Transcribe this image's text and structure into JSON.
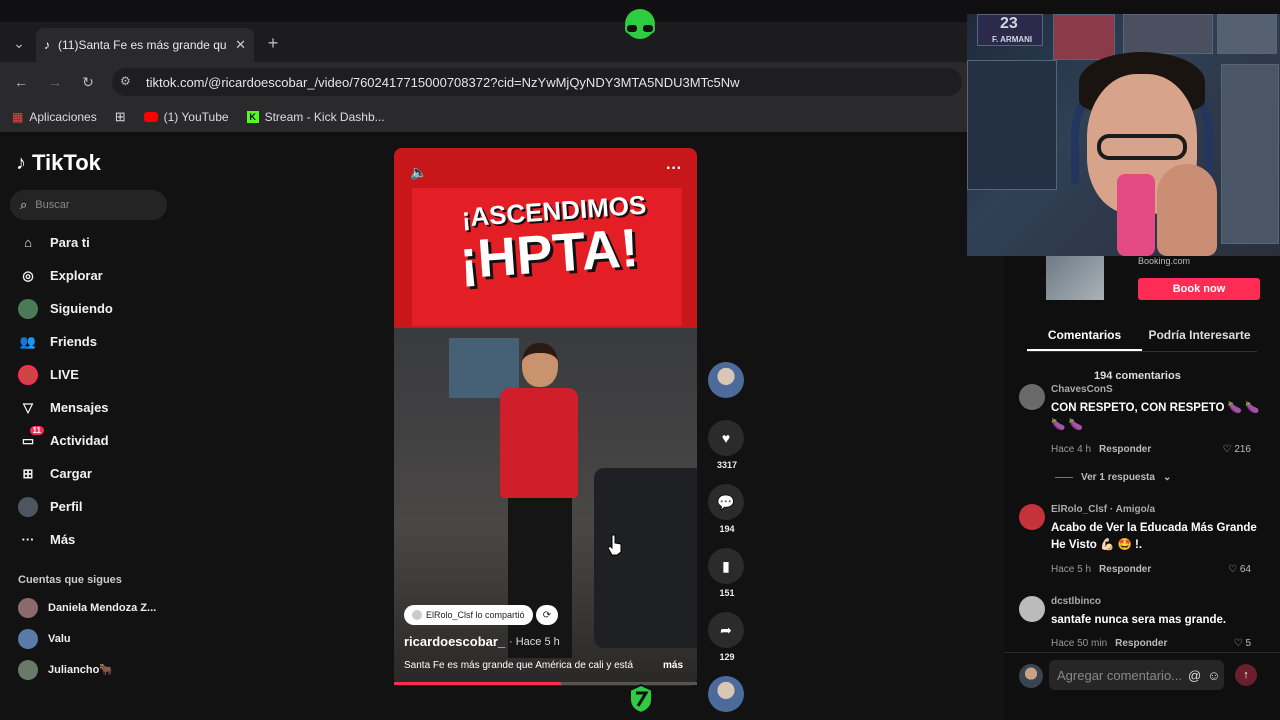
{
  "browser": {
    "tab_title": "(11)Santa Fe es más grande qu",
    "url": "tiktok.com/@ricardoescobar_/video/7602417715000708372?cid=NzYwMjQyNDY3MTA5NDU3MTc5Nw",
    "bookmarks": [
      {
        "label": "Aplicaciones"
      },
      {
        "label": "(1) YouTube"
      },
      {
        "label": "Stream - Kick Dashb..."
      }
    ]
  },
  "sidebar": {
    "brand": "TikTok",
    "search_placeholder": "Buscar",
    "items": [
      {
        "label": "Para ti"
      },
      {
        "label": "Explorar"
      },
      {
        "label": "Siguiendo"
      },
      {
        "label": "Friends"
      },
      {
        "label": "LIVE"
      },
      {
        "label": "Mensajes"
      },
      {
        "label": "Actividad",
        "badge": "11"
      },
      {
        "label": "Cargar"
      },
      {
        "label": "Perfil"
      },
      {
        "label": "Más"
      }
    ],
    "following_title": "Cuentas que sigues",
    "following": [
      {
        "label": "Daniela Mendoza Z..."
      },
      {
        "label": "Valu"
      },
      {
        "label": "Juliancho🐂"
      }
    ]
  },
  "video": {
    "overlay_line1": "¡ASCENDIMOS",
    "overlay_line2": "¡HPTA!",
    "shared_by": "ElRolo_Clsf lo compartió",
    "author": "ricardoescobar_",
    "time": "· Hace 5 h",
    "description": "Santa Fe es más grande que América de cali y está",
    "more": "más",
    "progress": 0.55
  },
  "actions": {
    "likes": "3317",
    "comments": "194",
    "saves": "151",
    "shares": "129"
  },
  "webcam": {
    "poster_text": "F. ARMANI",
    "poster_number": "23"
  },
  "ad": {
    "source": "Booking.com",
    "cta": "Book now"
  },
  "comments_panel": {
    "tabs": [
      "Comentarios",
      "Podría Interesarte"
    ],
    "count": "194 comentarios",
    "comments": [
      {
        "user": "ChavesConS",
        "text": "CON RESPETO, CON RESPETO 🍆 🍆 🍆 🍆",
        "time": "Hace 4 h",
        "reply": "Responder",
        "likes": "216"
      },
      {
        "user": "ElRolo_Clsf · Amigo/a",
        "text": "Acabo de Ver la Educada Más Grande He Visto 💪🏻 🤩 !.",
        "time": "Hace 5 h",
        "reply": "Responder",
        "likes": "64"
      },
      {
        "user": "dcstlbinco",
        "text": "santafe nunca sera mas grande.",
        "time": "Hace 50 min",
        "reply": "Responder",
        "likes": "5"
      }
    ],
    "view_replies": "Ver 1 respuesta",
    "input_placeholder": "Agregar comentario..."
  }
}
